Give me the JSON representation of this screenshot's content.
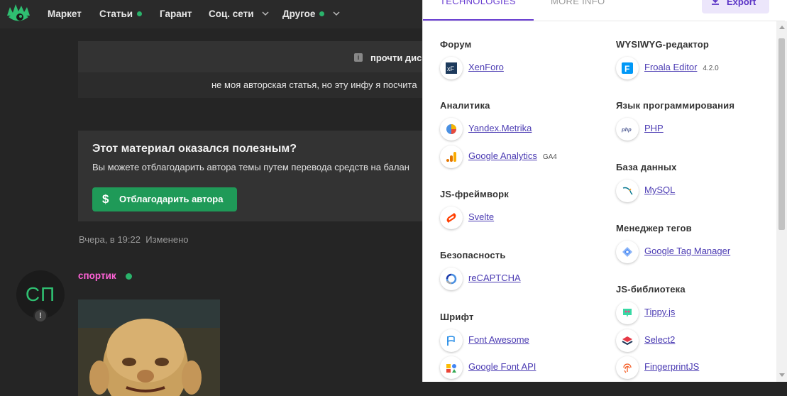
{
  "nav": {
    "items": [
      {
        "label": "Маркет"
      },
      {
        "label": "Статьи"
      },
      {
        "label": "Гарант"
      },
      {
        "label": "Соц. сети"
      },
      {
        "label": "Другое"
      }
    ]
  },
  "post": {
    "info_text": "прочти дис",
    "message_text": "не моя авторская статья, но эту инфу я посчита",
    "thanks_title": "Этот материал оказался полезным?",
    "thanks_sub": "Вы можете отблагодарить автора темы путем перевода средств на балан",
    "thanks_button": "Отблагодарить автора",
    "meta_time": "Вчера, в 19:22",
    "meta_edited": "Изменено"
  },
  "reply": {
    "avatar_initials": "СП",
    "avatar_badge": "!",
    "username": "спортик"
  },
  "panel": {
    "tab_technologies": "TECHNOLOGIES",
    "tab_more_info": "MORE INFO",
    "export_label": "Export",
    "left_column": [
      {
        "category": "Форум",
        "items": [
          {
            "name": "XenForo",
            "icon": "xenforo-icon"
          }
        ]
      },
      {
        "category": "Аналитика",
        "items": [
          {
            "name": "Yandex.Metrika",
            "icon": "yandex-metrika-icon"
          },
          {
            "name": "Google Analytics",
            "version": "GA4",
            "icon": "google-analytics-icon"
          }
        ]
      },
      {
        "category": "JS-фреймворк",
        "items": [
          {
            "name": "Svelte",
            "icon": "svelte-icon"
          }
        ]
      },
      {
        "category": "Безопасность",
        "items": [
          {
            "name": "reCAPTCHA",
            "icon": "recaptcha-icon"
          }
        ]
      },
      {
        "category": "Шрифт",
        "items": [
          {
            "name": "Font Awesome",
            "icon": "font-awesome-icon"
          },
          {
            "name": "Google Font API",
            "icon": "google-font-api-icon"
          }
        ]
      }
    ],
    "right_column": [
      {
        "category": "WYSIWYG-редактор",
        "items": [
          {
            "name": "Froala Editor",
            "version": "4.2.0",
            "icon": "froala-icon"
          }
        ]
      },
      {
        "category": "Язык программирования",
        "items": [
          {
            "name": "PHP",
            "icon": "php-icon"
          }
        ]
      },
      {
        "category": "База данных",
        "items": [
          {
            "name": "MySQL",
            "icon": "mysql-icon"
          }
        ]
      },
      {
        "category": "Менеджер тегов",
        "items": [
          {
            "name": "Google Tag Manager",
            "icon": "google-tag-manager-icon"
          }
        ]
      },
      {
        "category": "JS-библиотека",
        "items": [
          {
            "name": "Tippy.js",
            "icon": "tippy-icon"
          },
          {
            "name": "Select2",
            "icon": "select2-icon"
          },
          {
            "name": "FingerprintJS",
            "icon": "fingerprintjs-icon"
          }
        ]
      }
    ]
  },
  "colors": {
    "accent": "#6a3fd1",
    "green": "#2ab36b",
    "username_pink": "#ff62d7",
    "link": "#4b3bb3"
  }
}
